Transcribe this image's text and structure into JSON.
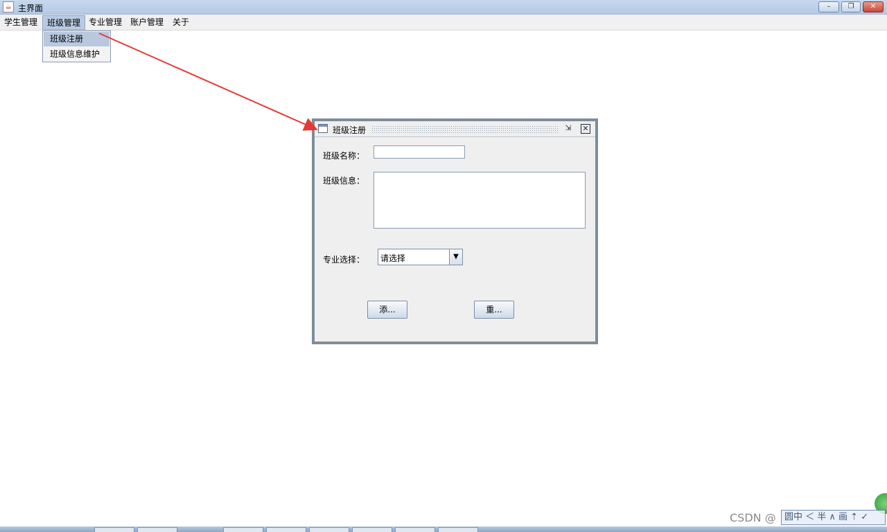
{
  "window": {
    "title": "主界面",
    "controls": {
      "minimize": "–",
      "maximize": "❐",
      "close": "✕"
    }
  },
  "menu": {
    "items": [
      "学生管理",
      "班级管理",
      "专业管理",
      "账户管理",
      "关于"
    ],
    "active": "班级管理",
    "dropdown": [
      "班级注册",
      "班级信息维护"
    ]
  },
  "dialog": {
    "title": "班级注册",
    "iconify_glyph": "⇲",
    "close_glyph": "✕",
    "fields": {
      "class_name_label": "班级名称：",
      "class_info_label": "班级信息：",
      "major_label": "专业选择：",
      "major_selected": "请选择"
    },
    "buttons": {
      "add": "添...",
      "reset": "重..."
    }
  },
  "overlay": {
    "watermark": "CSDN @",
    "toolbar_text": "圆中 ＜ 半 ∧ 画 ⇡ ✓",
    "arrow_color": "#e53935"
  }
}
